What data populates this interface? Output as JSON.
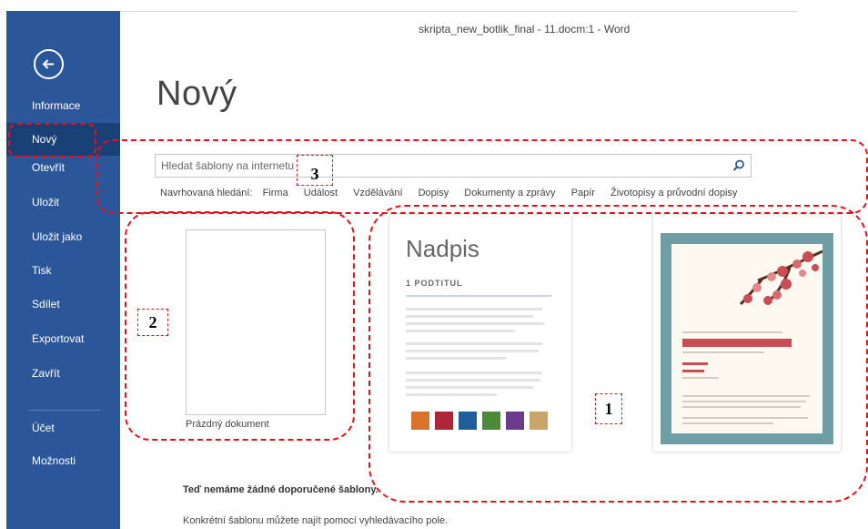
{
  "window": {
    "title": "skripta_new_botlik_final - 11.docm:1 - Word"
  },
  "sidebar": {
    "items": [
      {
        "label": "Informace"
      },
      {
        "label": "Nový"
      },
      {
        "label": "Otevřít"
      },
      {
        "label": "Uložit"
      },
      {
        "label": "Uložit jako"
      },
      {
        "label": "Tisk"
      },
      {
        "label": "Sdílet"
      },
      {
        "label": "Exportovat"
      },
      {
        "label": "Zavřít"
      },
      {
        "label": "Účet"
      },
      {
        "label": "Možnosti"
      }
    ],
    "active": "Nový"
  },
  "main": {
    "heading": "Nový",
    "search": {
      "placeholder": "Hledat šablony na internetu"
    },
    "suggested": {
      "label": "Navrhovaná hledání:",
      "links": [
        "Firma",
        "Událost",
        "Vzdělávání",
        "Dopisy",
        "Dokumenty a zprávy",
        "Papír",
        "Životopisy a průvodní dopisy"
      ]
    },
    "templates": {
      "blank_label": "Prázdný dokument",
      "nadpis_heading": "Nadpis",
      "nadpis_subheading": "1   PODTITUL",
      "swatch_colors": [
        "#d9722a",
        "#b0253a",
        "#1f5e9a",
        "#4b8a3a",
        "#6a3b8c",
        "#c9a56a"
      ]
    },
    "no_templates_text": "Teď nemáme žádné doporučené šablony.",
    "hint_text": "Konkrétní šablonu můžete najít pomocí vyhledávacího pole."
  },
  "annotations": {
    "labels": [
      "1",
      "2",
      "3"
    ],
    "color": "#e8101a"
  }
}
